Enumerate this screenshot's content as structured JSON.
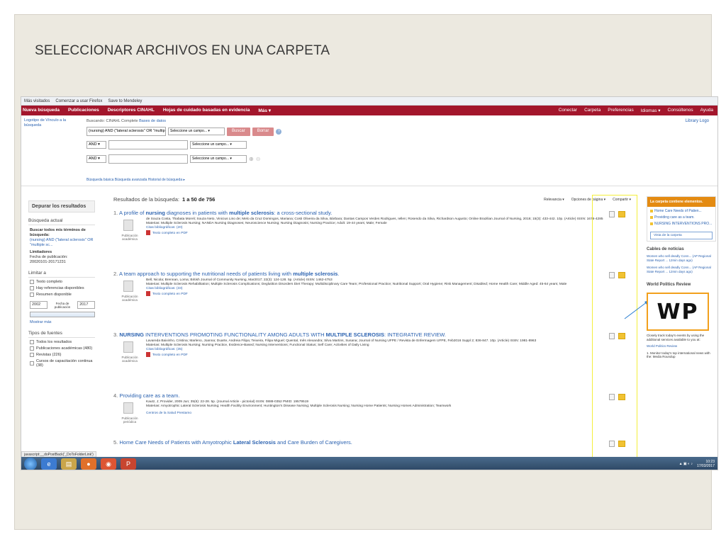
{
  "slide": {
    "title": "SELECCIONAR ARCHIVOS EN UNA CARPETA"
  },
  "bookmarks": [
    "Más visitados",
    "Comenzar a usar Firefox",
    "Save to Mendeley"
  ],
  "nav": {
    "left": [
      "Nueva búsqueda",
      "Publicaciones",
      "Descriptores CINAHL",
      "Hojas de cuidado basadas en evidencia",
      "Más ▾"
    ],
    "right": [
      "Conectar",
      "Carpeta",
      "Preferencias",
      "Idiomas ▾",
      "Consúltenos",
      "Ayuda"
    ]
  },
  "search": {
    "institution_link": "Logotipo de Vínculo a la búsqueda",
    "searching_label": "Buscando:",
    "database": "CINAHL Complete",
    "choose_db": "Bases de datos",
    "query": "(nursing) AND (\"lateral sclerosis\" OR \"multip",
    "field_placeholder": "Seleccione un campo... ▾",
    "and_label": "AND ▾",
    "search_button": "Buscar",
    "clear_button": "Borrar",
    "help": "?",
    "links": "Búsqueda básica   Búsqueda avanzada   Historial de búsqueda ▸",
    "library_logo": "Library Logo"
  },
  "left": {
    "refine_title": "Depurar los resultados",
    "current_search": "Búsqueda actual",
    "find_all_label": "Buscar todos mis términos de búsqueda:",
    "find_all_value": "(nursing) AND (\"lateral sclerosis\" OR \"multiple sc...",
    "limiters": "Limitadores",
    "pub_date_label": "Fecha de publicación:",
    "pub_date_value": "20020101-20171231",
    "limit_to": "Limitar a",
    "limit_options": [
      "Texto completo",
      "Hay referencias disponibles",
      "Resumen disponible"
    ],
    "year_from": "2002",
    "year_label": "Fecha de publicación",
    "year_to": "2017",
    "show_more": "Mostrar más",
    "source_types": "Tipos de fuentes",
    "source_options": [
      "Todos los resultados",
      "Publicaciones académicas (480)",
      "Revistas (226)",
      "Cursos de capacitación continua (38)"
    ]
  },
  "results": {
    "header_label": "Resultados de la búsqueda:",
    "header_count": "1 a 50 de 756",
    "controls": [
      "Relevancia ▾",
      "Opciones de página ▾",
      "Compartir ▾"
    ],
    "items": [
      {
        "num": "1.",
        "title_pre": "A profile of ",
        "title_b1": "nursing",
        "title_mid": " diagnoses in patients with ",
        "title_b2": "multiple sclerosis",
        "title_post": ": a cross-sectional study.",
        "line1": "de Souza Costa, Thabata Moreli; Souza Neto, Vinicius Lino de; Melo da Cruz Domingos, Mariana; Costi Oliveira da Silva, Bárbara; Dantas Campos Verdes Rodrigues, Iellen; Rosendo da Silva, Richardson Augusto; Online Brazilian Journal of Nursing, 2016; 15(3): 433-442. 10p. (Article) ISSN: 1676-4285",
        "line2": "Materias: Multiple Sclerosis Nursing; NANDA Nursing Diagnoses; Neuroscience Nursing; Nursing Diagnosis; Nursing Practice; Adult: 19-44 years; Male; Female",
        "cited": "Citas bibliográficas: (20)",
        "pdf": "Texto completo en PDF",
        "type": "Publicación académica"
      },
      {
        "num": "2.",
        "title_pre": "A team approach to supporting the nutritional needs of patients living with ",
        "title_b1": "multiple sclerosis",
        "title_mid": ".",
        "title_b2": "",
        "title_post": "",
        "line1": "Bell, Nicola; Brennan, Lorna; British Journal of Community Nursing, Mar2017; 22(3): 124-128. 5p. (Article) ISSN: 1462-4753",
        "line2": "Materias: Multiple Sclerosis Rehabilitation; Multiple Sclerosis Complications; Deglutition Disorders Diet Therapy; Multidisciplinary Care Team; Professional Practice; Nutritional Support; Oral Hygiene; Risk Management; Disabled; Home Health Care; Middle Aged: 45-64 years; Male",
        "cited": "Citas bibliográficas: (33)",
        "pdf": "Texto completo en PDF",
        "type": "Publicación académica"
      },
      {
        "num": "3.",
        "title_pre": "",
        "title_b1": "NURSING",
        "title_mid": " INTERVENTIONS PROMOTING FUNCTIONALITY AMONG ADULTS WITH ",
        "title_b2": "MULTIPLE SCLEROSIS",
        "title_post": ": INTEGRATIVE REVIEW.",
        "line1": "Lavareda Baixinho, Cristina; Marleno, Joanna; Duarte, Andreia Filipa; Teixeira, Filipa Miguel; Quental, Inês Alexandra; Silva Martins, Susana; Journal of Nursing UFPE / Revista de Enfermagem UFPE, Feb2016 Suppl 2; 836-847. 10p. (Article) ISSN: 1981-8963",
        "line2": "Materias: Multiple Sclerosis Nursing; Nursing Practice, Evidence-Based; Nursing Interventions; Functional Status; Self Care; Activities of Daily Living",
        "cited": "Citas bibliográficas: (35)",
        "pdf": "Texto completo en PDF",
        "type": "Publicación académica"
      },
      {
        "num": "4.",
        "title_pre": "Providing care as a team.",
        "title_b1": "",
        "title_mid": "",
        "title_b2": "",
        "title_post": "",
        "line1": "Kautz, J; Provider, 2009 Jun; 35(6): 22-28. 5p. (Journal Article - pictorial) ISSN: 0888-0352 PMID: 19579519",
        "line2": "Materias: Amyotrophic Lateral Sclerosis Nursing; Health Facility Environment; Huntington's Disease Nursing; Multiple Sclerosis Nursing; Nursing Home Patients; Nursing Homes Administration; Teamwork",
        "cited": "Centros de la Salud Prestamo",
        "pdf": "",
        "type": "Publicación periódica"
      },
      {
        "num": "5.",
        "title_pre": "Home Care Needs of Patients with Amyotrophic ",
        "title_b1": "Lateral Sclerosis",
        "title_mid": " and Care Burden of Caregivers.",
        "title_b2": "",
        "title_post": "",
        "line1": "",
        "line2": "",
        "cited": "",
        "pdf": "",
        "type": ""
      }
    ]
  },
  "folder": {
    "header": "La carpeta contiene elementos.",
    "items": [
      "Home Care Needs of Patien...",
      "Providing care as a team.",
      "NURSING INTERVENTIONS PRO..."
    ],
    "view_link": "Vista de la carpeta"
  },
  "news": {
    "title": "Cables de noticias",
    "items": [
      "Women who sell deadly Conn... (AP Regional State Report ... 12min days ago)",
      "Women who sell deadly Conn... (AP Regional State Report ... 12min days ago)"
    ],
    "wp_title": "World Politics Review",
    "wp_logo": "WP",
    "wp_text": "Closely track today's events by using the additional services available to you at:",
    "wp_link": "World Politics Review",
    "wp_item": "1. Monitor today's top international news with the: Media Roundup"
  },
  "status_url": "javascript:__doPostBack('_DoToFolderLink')",
  "taskbar": {
    "clock_time": "10:23",
    "clock_date": "17/03/2017"
  },
  "colors": {
    "nav_red": "#a3162c",
    "link_blue": "#2b62b0",
    "folder_orange": "#e48b12",
    "highlight_yellow": "#f4ee3a"
  }
}
